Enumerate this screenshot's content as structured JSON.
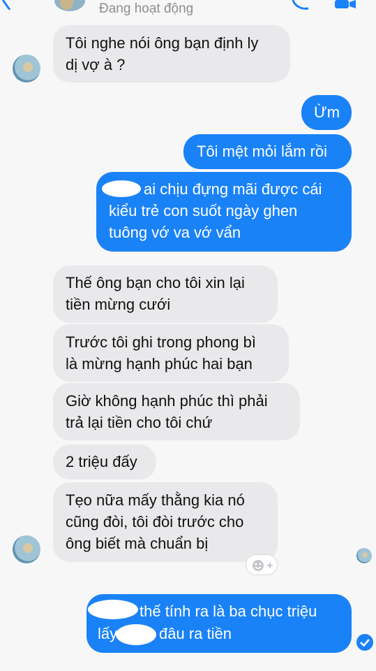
{
  "header": {
    "status": "Đang hoạt động",
    "back_icon": "back-arrow-icon",
    "call_icon": "phone-icon",
    "video_icon": "video-camera-icon"
  },
  "messages": [
    {
      "side": "in",
      "text": "Tôi nghe nói ông bạn định ly\ndị vợ à ?"
    },
    {
      "side": "out",
      "text": "Ừm"
    },
    {
      "side": "out",
      "text": "Tôi mệt mỏi lắm rồi"
    },
    {
      "side": "out",
      "text": "ai chịu đựng mãi được cái\nkiểu trẻ con suốt ngày ghen\ntuông vớ va vớ vẩn"
    },
    {
      "side": "in",
      "text": "Thế ông bạn cho tôi xin lại\ntiền mừng cưới"
    },
    {
      "side": "in",
      "text": "Trước tôi ghi trong phong bì\nlà mừng hạnh phúc hai bạn"
    },
    {
      "side": "in",
      "text": "Giờ không hạnh phúc thì phải\ntrả lại tiền cho tôi chứ"
    },
    {
      "side": "in",
      "text": "2 triệu đấy"
    },
    {
      "side": "in",
      "text": "Tẹo nữa mấy thằng kia nó\ncũng đòi, tôi đòi trước cho\nông biết mà chuẩn bị"
    },
    {
      "side": "out",
      "text_line1": "thế tính ra là ba chục triệu",
      "text_line2_left": "lấy",
      "text_line2_right": "đâu ra tiền"
    }
  ],
  "icons": {
    "add_reaction": "add-reaction-icon",
    "read_receipt": "seen-check-icon"
  },
  "colors": {
    "outgoing": "#1a82f7",
    "incoming": "#e9e9eb"
  }
}
